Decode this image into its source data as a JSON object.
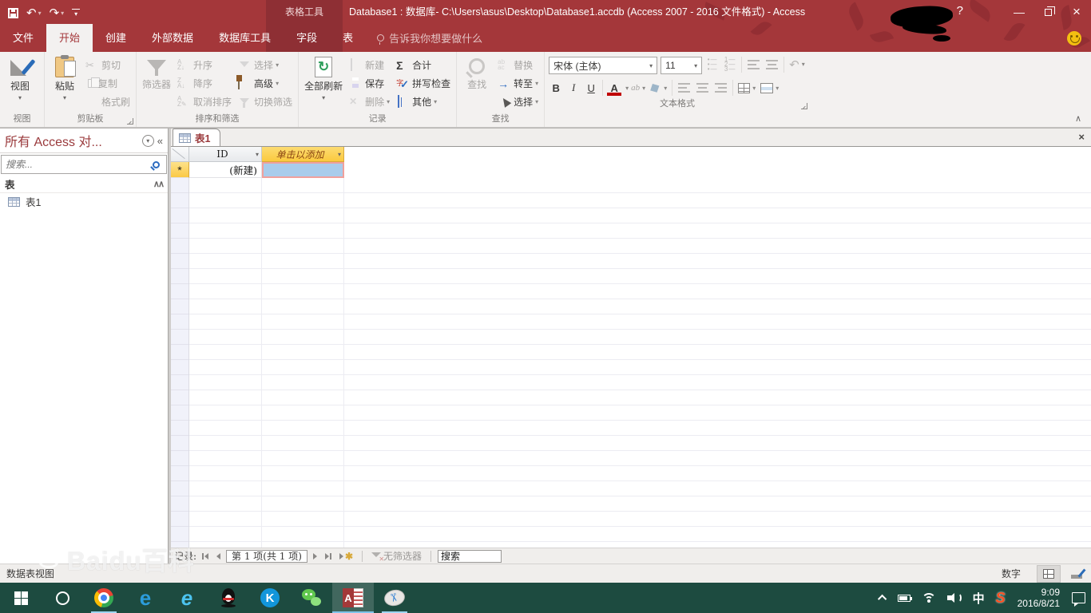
{
  "window": {
    "context_label": "表格工具",
    "title": "Database1 : 数据库- C:\\Users\\asus\\Desktop\\Database1.accdb (Access 2007 - 2016 文件格式) - Access",
    "help_glyph": "?",
    "minimize_glyph": "—",
    "close_glyph": "×"
  },
  "tabs": {
    "file": "文件",
    "home": "开始",
    "create": "创建",
    "external": "外部数据",
    "dbtools": "数据库工具",
    "fields": "字段",
    "table": "表",
    "tellme": "告诉我你想要做什么"
  },
  "ribbon": {
    "views": {
      "button": "视图",
      "group": "视图"
    },
    "clipboard": {
      "paste": "粘贴",
      "cut": "剪切",
      "copy": "复制",
      "painter": "格式刷",
      "group": "剪贴板"
    },
    "sortfilter": {
      "filter": "筛选器",
      "asc": "升序",
      "desc": "降序",
      "unsort": "取消排序",
      "selection": "选择",
      "advanced": "高级",
      "toggle": "切换筛选",
      "group": "排序和筛选"
    },
    "records": {
      "refresh": "全部刷新",
      "new": "新建",
      "save": "保存",
      "delete": "删除",
      "totals": "合计",
      "spelling": "拼写检查",
      "more": "其他",
      "group": "记录"
    },
    "find": {
      "find": "查找",
      "replace": "替换",
      "goto": "转至",
      "select": "选择",
      "group": "查找"
    },
    "textformat": {
      "font": "宋体 (主体)",
      "size": "11",
      "bold": "B",
      "italic": "I",
      "underline": "U",
      "fontcolor": "A",
      "group": "文本格式"
    }
  },
  "nav": {
    "title": "所有 Access 对...",
    "search_placeholder": "搜索...",
    "group_tables": "表",
    "table1": "表1"
  },
  "sheet": {
    "tab": "表1",
    "col_id": "ID",
    "col_add": "单击以添加",
    "new_record": "(新建)",
    "row_star": "*"
  },
  "recordbar": {
    "label": "记录:",
    "position": "第 1 项(共 1 项)",
    "no_filter": "无筛选器",
    "search": "搜索"
  },
  "statusbar": {
    "view": "数据表视图",
    "datatype": "数字"
  },
  "taskbar": {
    "edge": "e",
    "ie": "e",
    "kugou": "K",
    "ime": "中",
    "sogou": "S",
    "time": "9:09",
    "date": "2016/8/21"
  },
  "watermark": "Baidu百科",
  "colors": {
    "accent": "#a4373a",
    "context": "#8e2f34",
    "taskbar": "#1d4b40",
    "add_header": "#fbca3e",
    "active_cell": "#a9cceb",
    "active_cell_border": "#f0a09c"
  }
}
